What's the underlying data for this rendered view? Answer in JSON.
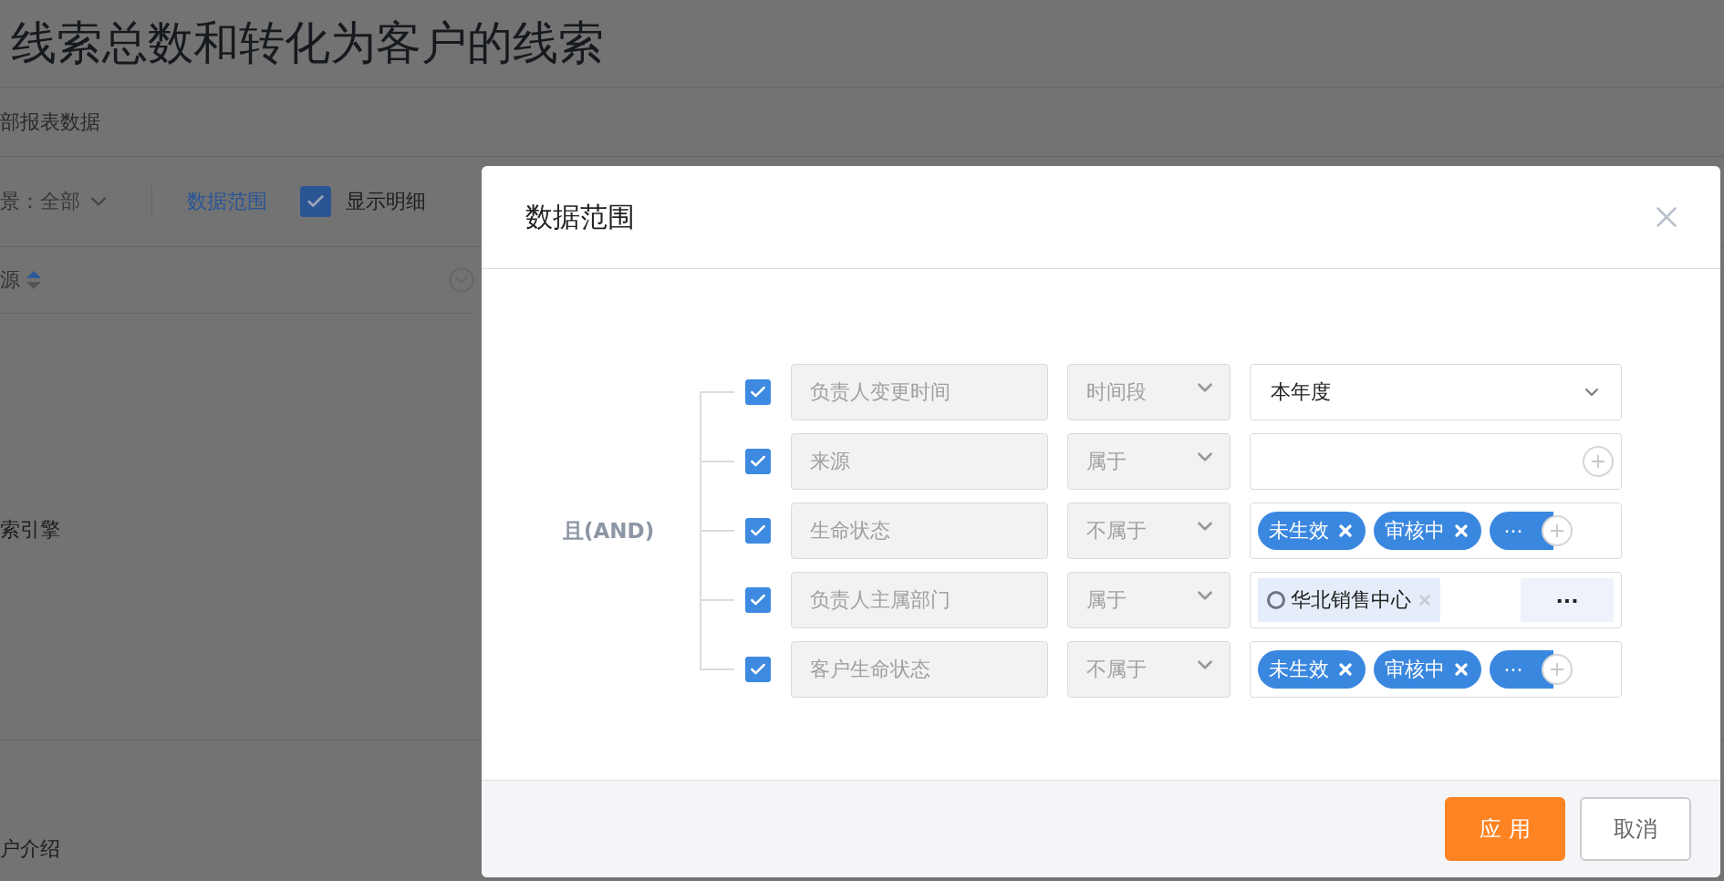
{
  "page": {
    "title": "线索总数和转化为客户的线索",
    "breadcrumb": "部报表数据",
    "filter": {
      "label": "景：",
      "value": "全部"
    },
    "link": "数据范围",
    "show_detail": {
      "label": "显示明细",
      "checked": true
    },
    "column": "源",
    "rows": [
      "索引擎",
      "户介绍"
    ]
  },
  "dialog": {
    "title": "数据范围",
    "logic": "且(AND)",
    "conditions": [
      {
        "checked": true,
        "field": "负责人变更时间",
        "operator": "时间段",
        "value": {
          "kind": "select",
          "text": "本年度"
        }
      },
      {
        "checked": true,
        "field": "来源",
        "operator": "属于",
        "value": {
          "kind": "picker"
        }
      },
      {
        "checked": true,
        "field": "生命状态",
        "operator": "不属于",
        "value": {
          "kind": "tags",
          "tags": [
            "未生效",
            "审核中"
          ],
          "more": "···"
        }
      },
      {
        "checked": true,
        "field": "负责人主属部门",
        "operator": "属于",
        "value": {
          "kind": "org",
          "tags": [
            "华北销售中心"
          ],
          "more": "···"
        }
      },
      {
        "checked": true,
        "field": "客户生命状态",
        "operator": "不属于",
        "value": {
          "kind": "tags",
          "tags": [
            "未生效",
            "审核中"
          ],
          "more": "···"
        }
      }
    ],
    "buttons": [
      {
        "label": "应 用",
        "kind": "primary"
      },
      {
        "label": "取消",
        "kind": "secondary"
      }
    ]
  }
}
